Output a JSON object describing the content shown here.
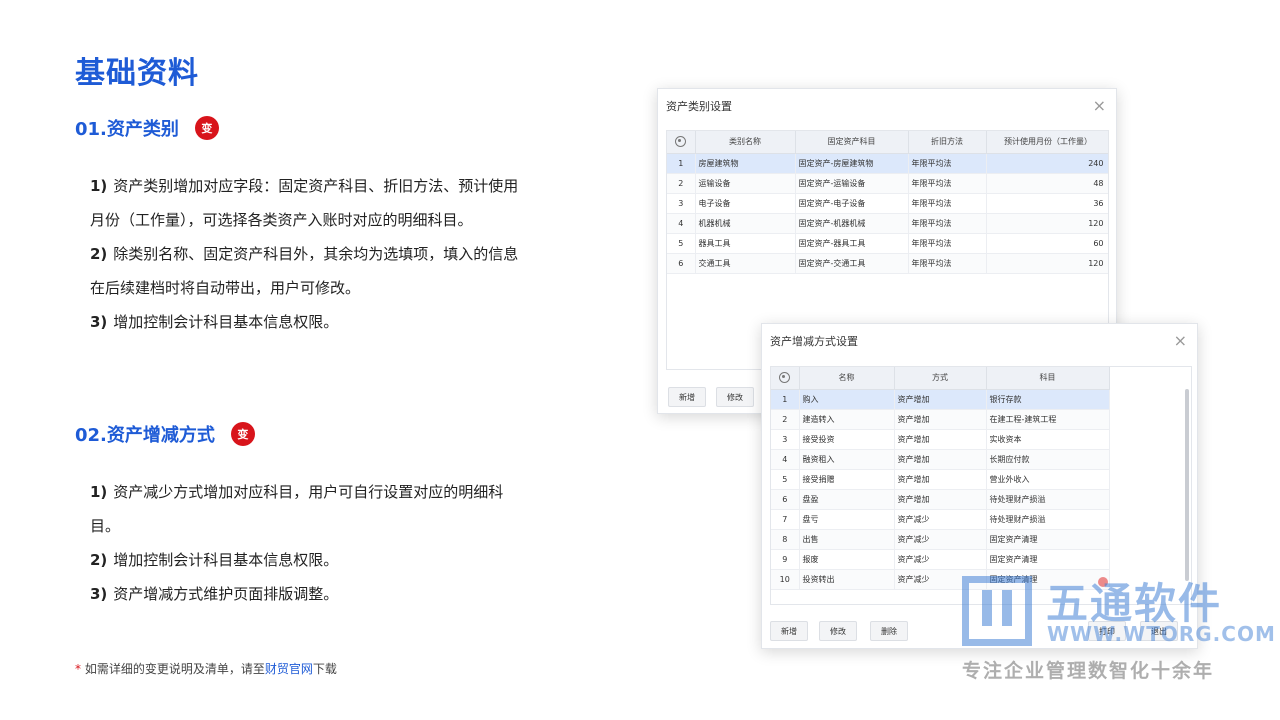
{
  "page": {
    "title": "基础资料",
    "sections": [
      {
        "heading": "01.资产类别",
        "badge": "变",
        "points": [
          {
            "num": "1)",
            "text": "资产类别增加对应字段：固定资产科目、折旧方法、预计使用月份（工作量），可选择各类资产入账时对应的明细科目。"
          },
          {
            "num": "2)",
            "text": "除类别名称、固定资产科目外，其余均为选填项，填入的信息在后续建档时将自动带出，用户可修改。"
          },
          {
            "num": "3)",
            "text": "增加控制会计科目基本信息权限。"
          }
        ]
      },
      {
        "heading": "02.资产增减方式",
        "badge": "变",
        "points": [
          {
            "num": "1)",
            "text": "资产减少方式增加对应科目，用户可自行设置对应的明细科目。"
          },
          {
            "num": "2)",
            "text": "增加控制会计科目基本信息权限。"
          },
          {
            "num": "3)",
            "text": "资产增减方式维护页面排版调整。"
          }
        ]
      }
    ],
    "footnote": {
      "star": "*",
      "prefix": "如需详细的变更说明及清单，请至",
      "link": "财贸官网",
      "suffix": "下载"
    }
  },
  "dialog1": {
    "title": "资产类别设置",
    "close": "×",
    "columns": [
      "",
      "类别名称",
      "固定资产科目",
      "折旧方法",
      "预计使用月份（工作量）"
    ],
    "rows": [
      [
        "1",
        "房屋建筑物",
        "固定资产-房屋建筑物",
        "年限平均法",
        "240"
      ],
      [
        "2",
        "运输设备",
        "固定资产-运输设备",
        "年限平均法",
        "48"
      ],
      [
        "3",
        "电子设备",
        "固定资产-电子设备",
        "年限平均法",
        "36"
      ],
      [
        "4",
        "机器机械",
        "固定资产-机器机械",
        "年限平均法",
        "120"
      ],
      [
        "5",
        "器具工具",
        "固定资产-器具工具",
        "年限平均法",
        "60"
      ],
      [
        "6",
        "交通工具",
        "固定资产-交通工具",
        "年限平均法",
        "120"
      ]
    ],
    "buttons": [
      "新增",
      "修改"
    ]
  },
  "dialog2": {
    "title": "资产增减方式设置",
    "close": "×",
    "columns": [
      "",
      "名称",
      "方式",
      "科目"
    ],
    "rows": [
      [
        "1",
        "购入",
        "资产增加",
        "银行存款"
      ],
      [
        "2",
        "建造转入",
        "资产增加",
        "在建工程-建筑工程"
      ],
      [
        "3",
        "接受投资",
        "资产增加",
        "实收资本"
      ],
      [
        "4",
        "融资租入",
        "资产增加",
        "长期应付款"
      ],
      [
        "5",
        "接受捐赠",
        "资产增加",
        "营业外收入"
      ],
      [
        "6",
        "盘盈",
        "资产增加",
        "待处理财产损溢"
      ],
      [
        "7",
        "盘亏",
        "资产减少",
        "待处理财产损溢"
      ],
      [
        "8",
        "出售",
        "资产减少",
        "固定资产清理"
      ],
      [
        "9",
        "报废",
        "资产减少",
        "固定资产清理"
      ],
      [
        "10",
        "投资转出",
        "资产减少",
        "固定资产清理"
      ]
    ],
    "buttons": [
      "新增",
      "修改",
      "删除"
    ],
    "footer_buttons": [
      "打印",
      "退出"
    ]
  },
  "watermark": {
    "name": "五通软件",
    "url": "WWW.WTORG.COM",
    "slogan": "专注企业管理数智化十余年"
  }
}
